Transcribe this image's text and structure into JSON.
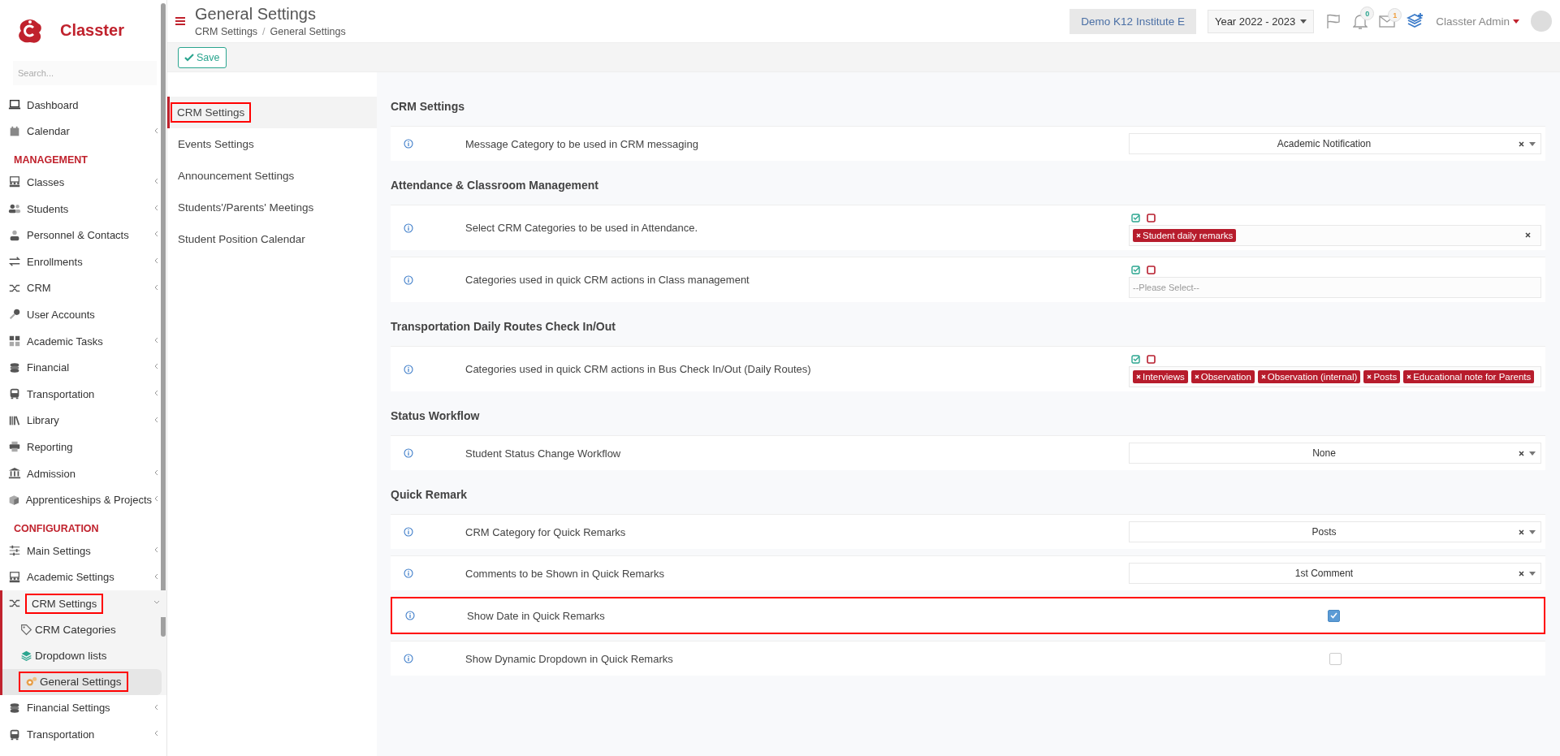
{
  "brand": {
    "name": "Classter"
  },
  "sidebar": {
    "search": {
      "placeholder": "Search..."
    },
    "items": [
      {
        "kind": "link",
        "label": "Dashboard",
        "has_submenu": false
      },
      {
        "kind": "link",
        "label": "Calendar",
        "has_submenu": true
      },
      {
        "kind": "header",
        "label": "MANAGEMENT"
      },
      {
        "kind": "link",
        "label": "Classes",
        "has_submenu": true
      },
      {
        "kind": "link",
        "label": "Students",
        "has_submenu": true
      },
      {
        "kind": "link",
        "label": "Personnel & Contacts",
        "has_submenu": true
      },
      {
        "kind": "link",
        "label": "Enrollments",
        "has_submenu": true
      },
      {
        "kind": "link",
        "label": "CRM",
        "has_submenu": true
      },
      {
        "kind": "link",
        "label": "User Accounts",
        "has_submenu": false
      },
      {
        "kind": "link",
        "label": "Academic Tasks",
        "has_submenu": true
      },
      {
        "kind": "link",
        "label": "Financial",
        "has_submenu": true
      },
      {
        "kind": "link",
        "label": "Transportation",
        "has_submenu": true
      },
      {
        "kind": "link",
        "label": "Library",
        "has_submenu": true
      },
      {
        "kind": "link",
        "label": "Reporting",
        "has_submenu": false
      },
      {
        "kind": "link",
        "label": "Admission",
        "has_submenu": true
      },
      {
        "kind": "link",
        "label": "Apprenticeships & Projects",
        "has_submenu": true
      },
      {
        "kind": "header",
        "label": "CONFIGURATION"
      },
      {
        "kind": "link",
        "label": "Main Settings",
        "has_submenu": true
      },
      {
        "kind": "link",
        "label": "Academic Settings",
        "has_submenu": true
      },
      {
        "kind": "link",
        "label": "CRM Settings",
        "has_submenu": true,
        "expanded": true,
        "highlighted": true,
        "children": [
          {
            "label": "CRM Categories",
            "selected": false,
            "highlighted": false
          },
          {
            "label": "Dropdown lists",
            "selected": false,
            "highlighted": false
          },
          {
            "label": "General Settings",
            "selected": true,
            "highlighted": true
          }
        ]
      },
      {
        "kind": "link",
        "label": "Financial Settings",
        "has_submenu": true
      },
      {
        "kind": "link",
        "label": "Transportation",
        "has_submenu": true
      }
    ]
  },
  "header": {
    "title": "General Settings",
    "breadcrumb": [
      "CRM Settings",
      "General Settings"
    ],
    "breadcrumb_separator": "/",
    "institute": "Demo K12 Institute E",
    "year": "Year 2022 - 2023",
    "notifications_badge": "0",
    "messages_badge": "1",
    "user": "Classter Admin"
  },
  "toolbar": {
    "save": "Save"
  },
  "subnav": [
    {
      "label": "CRM Settings",
      "selected": true,
      "highlighted": true
    },
    {
      "label": "Events Settings",
      "selected": false,
      "highlighted": false
    },
    {
      "label": "Announcement Settings",
      "selected": false,
      "highlighted": false
    },
    {
      "label": "Students'/Parents' Meetings",
      "selected": false,
      "highlighted": false
    },
    {
      "label": "Student Position Calendar",
      "selected": false,
      "highlighted": false
    }
  ],
  "sections": [
    {
      "title": "CRM Settings",
      "rows": [
        {
          "kind": "select",
          "label": "Message Category to be used in CRM messaging",
          "value": "Academic Notification",
          "highlighted": false
        }
      ]
    },
    {
      "title": "Attendance & Classroom Management",
      "rows": [
        {
          "kind": "multiselect",
          "label": "Select CRM Categories to be used in Attendance.",
          "tags": [
            "Student daily remarks"
          ],
          "highlighted": false
        },
        {
          "kind": "multiselect",
          "label": "Categories used in quick CRM actions in Class management",
          "placeholder": "--Please Select--",
          "highlighted": false
        }
      ]
    },
    {
      "title": "Transportation Daily Routes Check In/Out",
      "rows": [
        {
          "kind": "multiselect",
          "label": "Categories used in quick CRM actions in Bus Check In/Out (Daily Routes)",
          "tags": [
            "Interviews",
            "Observation",
            "Observation (internal)",
            "Posts",
            "Educational note for Parents"
          ],
          "highlighted": false
        }
      ]
    },
    {
      "title": "Status Workflow",
      "rows": [
        {
          "kind": "select",
          "label": "Student Status Change Workflow",
          "value": "None",
          "highlighted": false
        }
      ]
    },
    {
      "title": "Quick Remark",
      "rows": [
        {
          "kind": "select",
          "label": "CRM Category for Quick Remarks",
          "value": "Posts",
          "highlighted": false
        },
        {
          "kind": "select",
          "label": "Comments to be Shown in Quick Remarks",
          "value": "1st Comment",
          "highlighted": false
        },
        {
          "kind": "checkbox",
          "label": "Show Date in Quick Remarks",
          "checked": true,
          "highlighted": true
        },
        {
          "kind": "checkbox",
          "label": "Show Dynamic Dropdown in Quick Remarks",
          "checked": false,
          "highlighted": false
        }
      ]
    }
  ]
}
